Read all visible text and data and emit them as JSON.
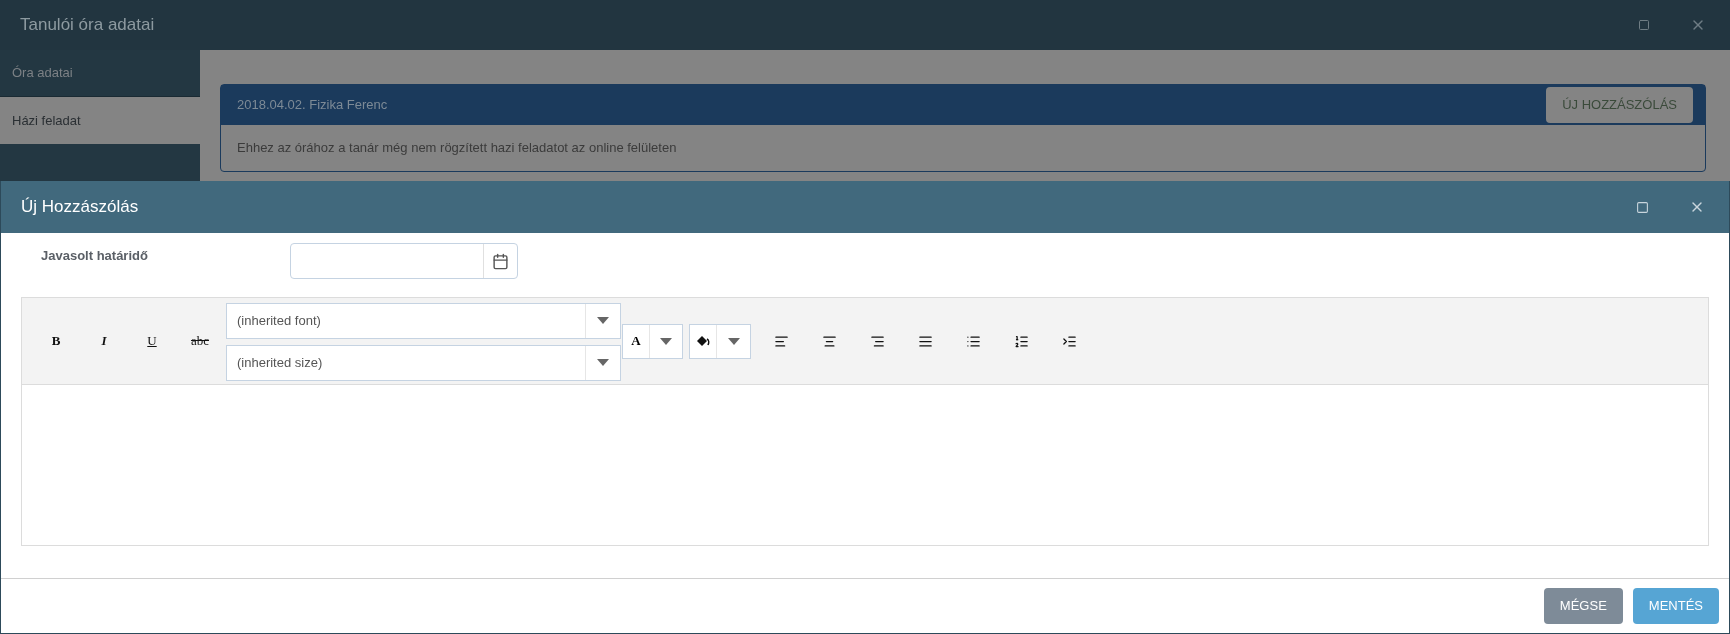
{
  "window": {
    "title": "Tanulói óra adatai"
  },
  "sidebar": {
    "items": [
      {
        "label": "Óra adatai",
        "selected": false
      },
      {
        "label": "Házi feladat",
        "selected": true
      }
    ]
  },
  "card": {
    "title": "2018.04.02. Fizika Ferenc",
    "button": "ÚJ HOZZÁSZÓLÁS",
    "message": "Ehhez az órához a tanár még nem rögzített hazi feladatot az online felületen"
  },
  "dialog": {
    "title": "Új Hozzászólás",
    "field": {
      "label": "Javasolt határidő"
    },
    "toolbar": {
      "format_buttons": [
        {
          "label": "B",
          "kind": "bold"
        },
        {
          "label": "I",
          "kind": "italic"
        },
        {
          "label": "U",
          "kind": "underline"
        },
        {
          "label": "abc",
          "kind": "strike"
        }
      ],
      "font_select": "(inherited font)",
      "size_select": "(inherited size)",
      "color_letter": "A"
    },
    "buttons": [
      {
        "label": "MÉGSE",
        "kind": "secondary"
      },
      {
        "label": "MENTÉS",
        "kind": "primary"
      }
    ]
  }
}
